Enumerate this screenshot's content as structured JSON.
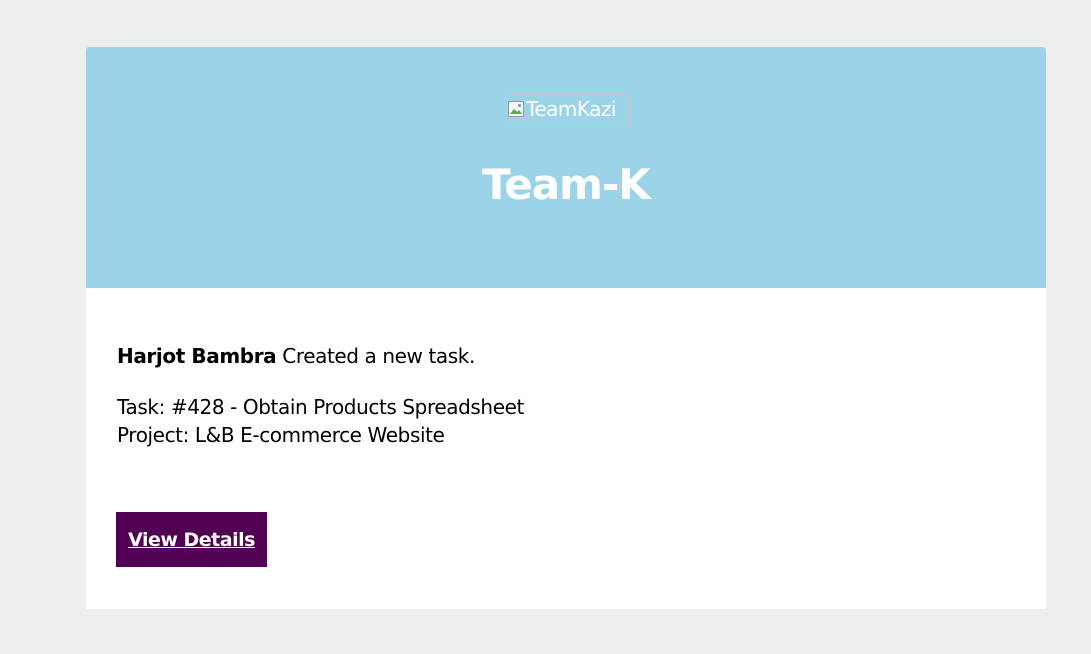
{
  "header": {
    "logo_alt": "TeamKazi",
    "logo_icon": "broken-image-icon",
    "brand_title": "Team-K",
    "background_color": "#9bd4e9"
  },
  "notification": {
    "actor_name": "Harjot Bambra",
    "action_text": "Created a new task.",
    "task_line": "Task: #428 - Obtain Products Spreadsheet",
    "project_line": "Project: L&B E-commerce Website"
  },
  "cta": {
    "label": "View Details",
    "background_color": "#520054"
  }
}
